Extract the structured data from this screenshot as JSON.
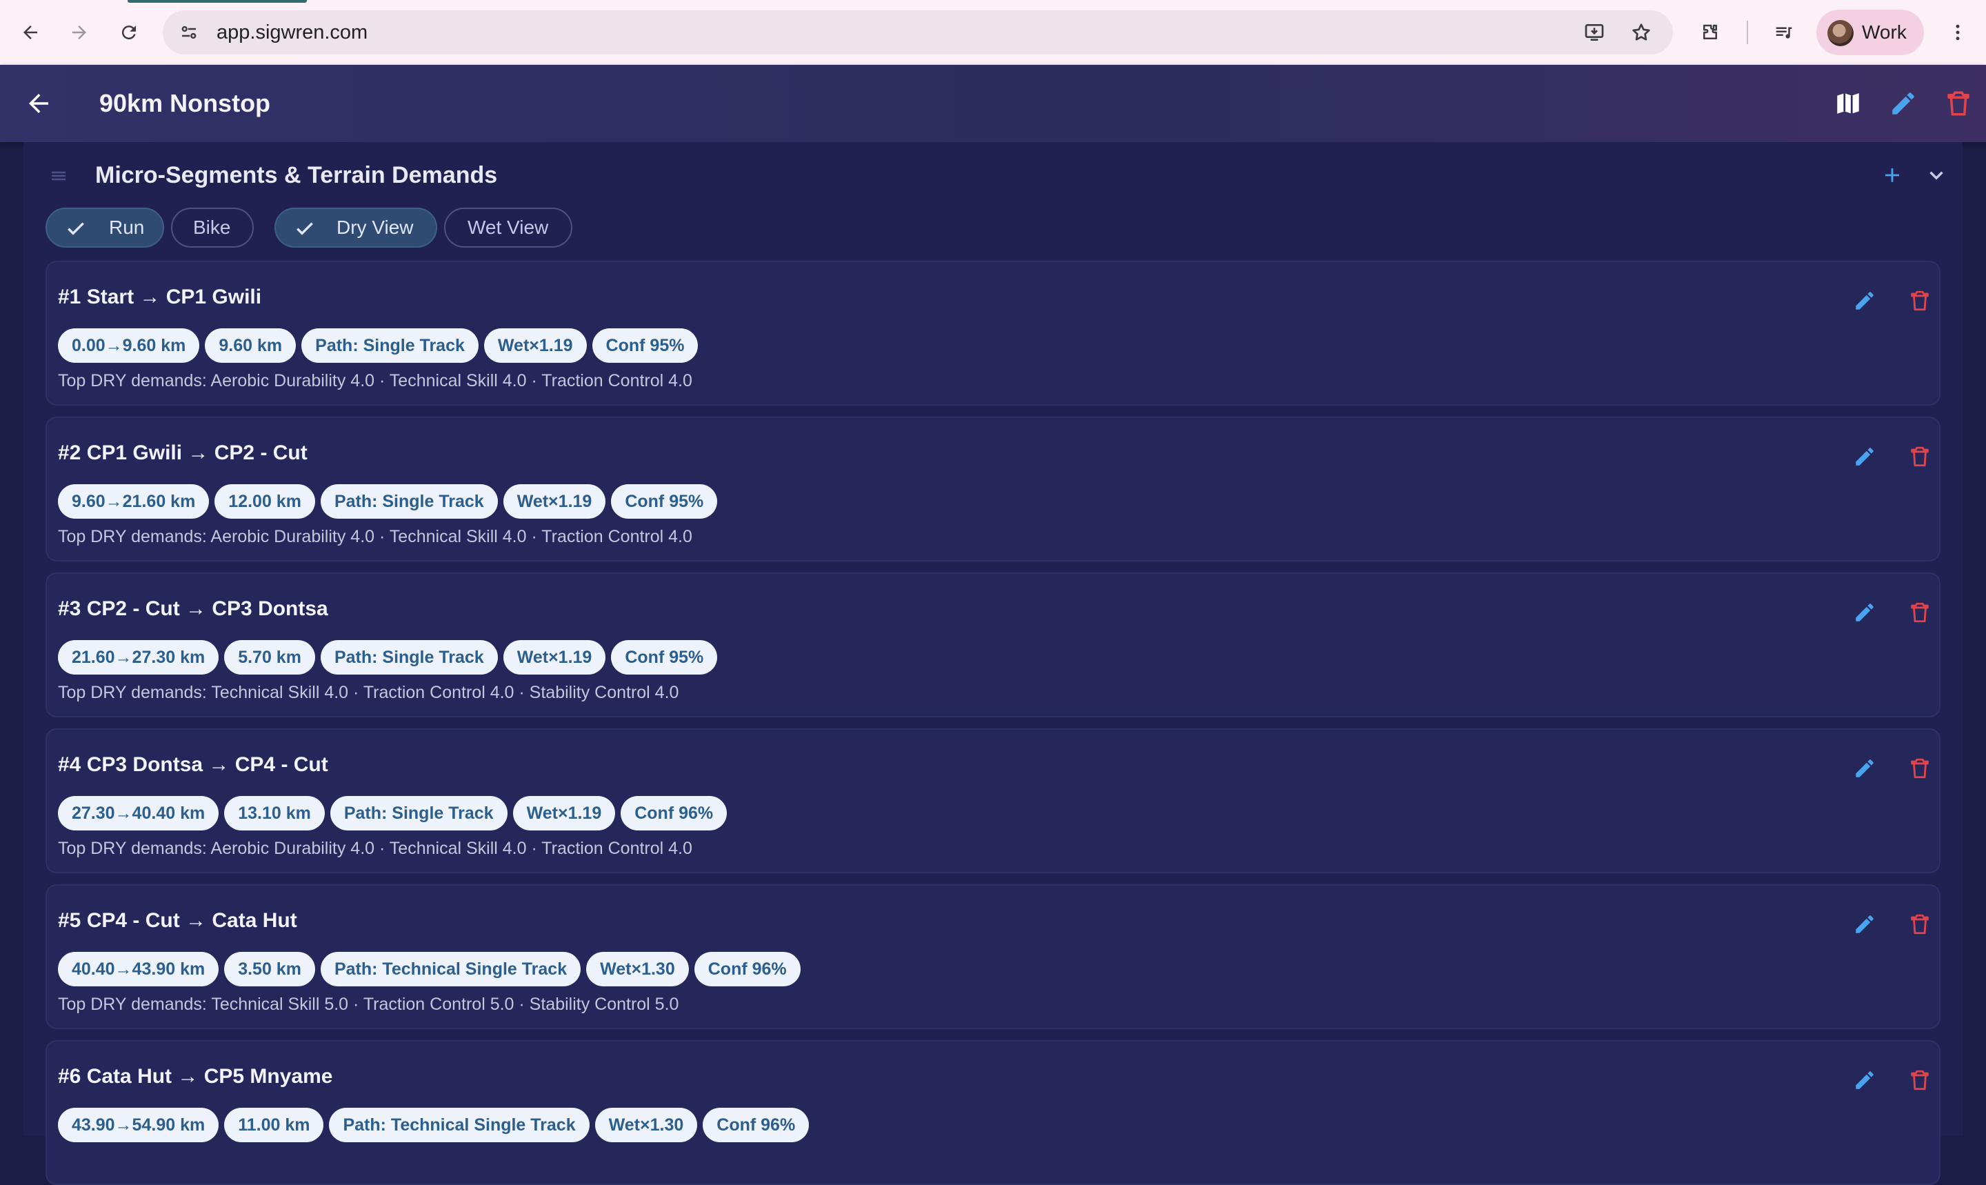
{
  "browser": {
    "url": "app.sigwren.com",
    "profile_name": "Work"
  },
  "header": {
    "title": "90km Nonstop"
  },
  "section": {
    "title": "Micro-Segments & Terrain Demands",
    "filters": [
      {
        "label": "Run",
        "selected": true
      },
      {
        "label": "Bike",
        "selected": false
      },
      {
        "label": "Dry View",
        "selected": true
      },
      {
        "label": "Wet View",
        "selected": false
      }
    ]
  },
  "segments": [
    {
      "title": "#1 Start → CP1 Gwili",
      "range": "0.00→9.60 km",
      "distance": "9.60 km",
      "path": "Path: Single Track",
      "wet": "Wet×1.19",
      "conf": "Conf 95%",
      "demands": "Top DRY demands: Aerobic Durability 4.0 · Technical Skill 4.0 · Traction Control 4.0"
    },
    {
      "title": "#2 CP1 Gwili → CP2 - Cut",
      "range": "9.60→21.60 km",
      "distance": "12.00 km",
      "path": "Path: Single Track",
      "wet": "Wet×1.19",
      "conf": "Conf 95%",
      "demands": "Top DRY demands: Aerobic Durability 4.0 · Technical Skill 4.0 · Traction Control 4.0"
    },
    {
      "title": "#3 CP2 - Cut → CP3 Dontsa",
      "range": "21.60→27.30 km",
      "distance": "5.70 km",
      "path": "Path: Single Track",
      "wet": "Wet×1.19",
      "conf": "Conf 95%",
      "demands": "Top DRY demands: Technical Skill 4.0 · Traction Control 4.0 · Stability Control 4.0"
    },
    {
      "title": "#4 CP3 Dontsa → CP4 - Cut",
      "range": "27.30→40.40 km",
      "distance": "13.10 km",
      "path": "Path: Single Track",
      "wet": "Wet×1.19",
      "conf": "Conf 96%",
      "demands": "Top DRY demands: Aerobic Durability 4.0 · Technical Skill 4.0 · Traction Control 4.0"
    },
    {
      "title": "#5 CP4 - Cut → Cata Hut",
      "range": "40.40→43.90 km",
      "distance": "3.50 km",
      "path": "Path: Technical Single Track",
      "wet": "Wet×1.30",
      "conf": "Conf 96%",
      "demands": "Top DRY demands: Technical Skill 5.0 · Traction Control 5.0 · Stability Control 5.0"
    },
    {
      "title": "#6 Cata Hut → CP5 Mnyame",
      "range": "43.90→54.90 km",
      "distance": "11.00 km",
      "path": "Path: Technical Single Track",
      "wet": "Wet×1.30",
      "conf": "Conf 96%",
      "demands": ""
    }
  ],
  "colors": {
    "accent_blue": "#4aa3ee",
    "delete_red": "#e2434b",
    "pill_text": "#2c5e8e"
  }
}
